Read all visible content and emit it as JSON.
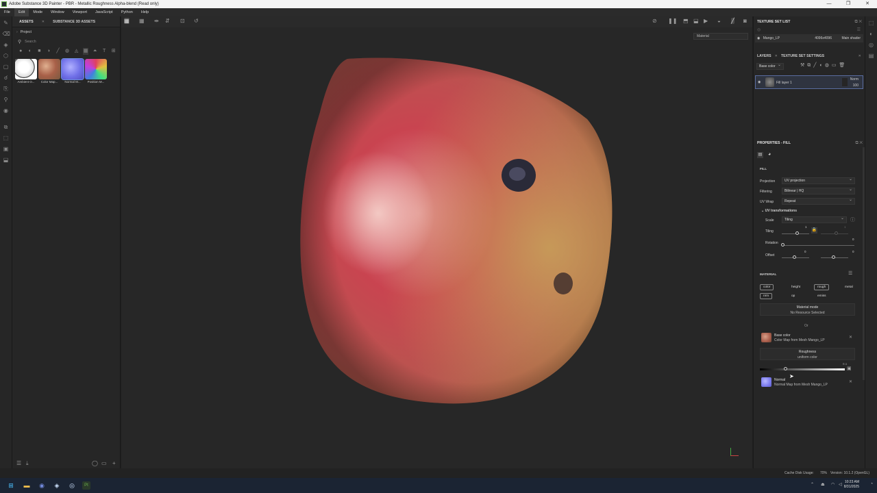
{
  "window": {
    "title": "Adobe Substance 3D Painter - PBR - Metallic Roughness Alpha-blend (Read only)",
    "controls": [
      "—",
      "❐",
      "✕"
    ]
  },
  "menu": [
    "File",
    "Edit",
    "Mode",
    "Window",
    "Viewport",
    "JavaScript",
    "Python",
    "Help"
  ],
  "assets": {
    "tabs": [
      "ASSETS",
      "SUBSTANCE 3D ASSETS"
    ],
    "project_label": "Project",
    "search_placeholder": "Search",
    "items": [
      {
        "label": "Ambient O...",
        "color": "#f4f4f4"
      },
      {
        "label": "Color Map...",
        "color": "#b07050"
      },
      {
        "label": "Normal M...",
        "color": "#8080f0"
      },
      {
        "label": "Position M...",
        "color": "#c060c0"
      }
    ]
  },
  "viewport": {
    "mode": "Material",
    "model_colors": {
      "skin_main": "#c9414a",
      "skin_warm": "#b98a4c",
      "highlight": "#f1c0b8",
      "spot": "#2b2b3a"
    }
  },
  "texture_set_list": {
    "title": "TEXTURE SET LIST",
    "name": "Mango_LP",
    "resolution": "4096x4096",
    "shader": "Main shader"
  },
  "layers": {
    "tabs": [
      "LAYERS",
      "TEXTURE SET SETTINGS"
    ],
    "channel": "Base color",
    "items": [
      {
        "name": "Fill layer 1",
        "blend": "Norm",
        "opacity": "100"
      }
    ]
  },
  "properties": {
    "title": "PROPERTIES - FILL",
    "section_fill": "FILL",
    "projection": {
      "label": "Projection",
      "value": "UV projection"
    },
    "filtering": {
      "label": "Filtering",
      "value": "Bilinear | HQ"
    },
    "uvwrap": {
      "label": "UV Wrap",
      "value": "Repeat"
    },
    "uv_transformations": "UV transformations",
    "scale": {
      "label": "Scale",
      "value": "Tiling"
    },
    "tiling": {
      "label": "Tiling",
      "value": "1",
      "value2": "1"
    },
    "rotation": {
      "label": "Rotation",
      "value": "0"
    },
    "offset": {
      "label": "Offset",
      "value1": "0",
      "value2": "0"
    },
    "section_material": "MATERIAL",
    "material_chips": [
      "color",
      "height",
      "rough",
      "metal",
      "nrm",
      "op",
      "emiss"
    ],
    "material_mode": {
      "title": "Material mode",
      "value": "No Resource Selected"
    },
    "or_text": "Or",
    "base_color": {
      "title": "Base color",
      "source": "Color Map from Mesh Mango_LP",
      "color": "#a85c4a"
    },
    "roughness": {
      "title": "Roughness",
      "source": "uniform color",
      "value": "0.1"
    },
    "normal": {
      "title": "Normal",
      "source": "Normal Map from Mesh Mango_LP",
      "color": "#7f7fef"
    }
  },
  "status": {
    "cache": "Cache Disk Usage:",
    "cache_value": "70%",
    "version": "Version: 10.1.2 (OpenGL)"
  },
  "taskbar": {
    "time": "10:23 AM",
    "date": "8/31/2025"
  }
}
